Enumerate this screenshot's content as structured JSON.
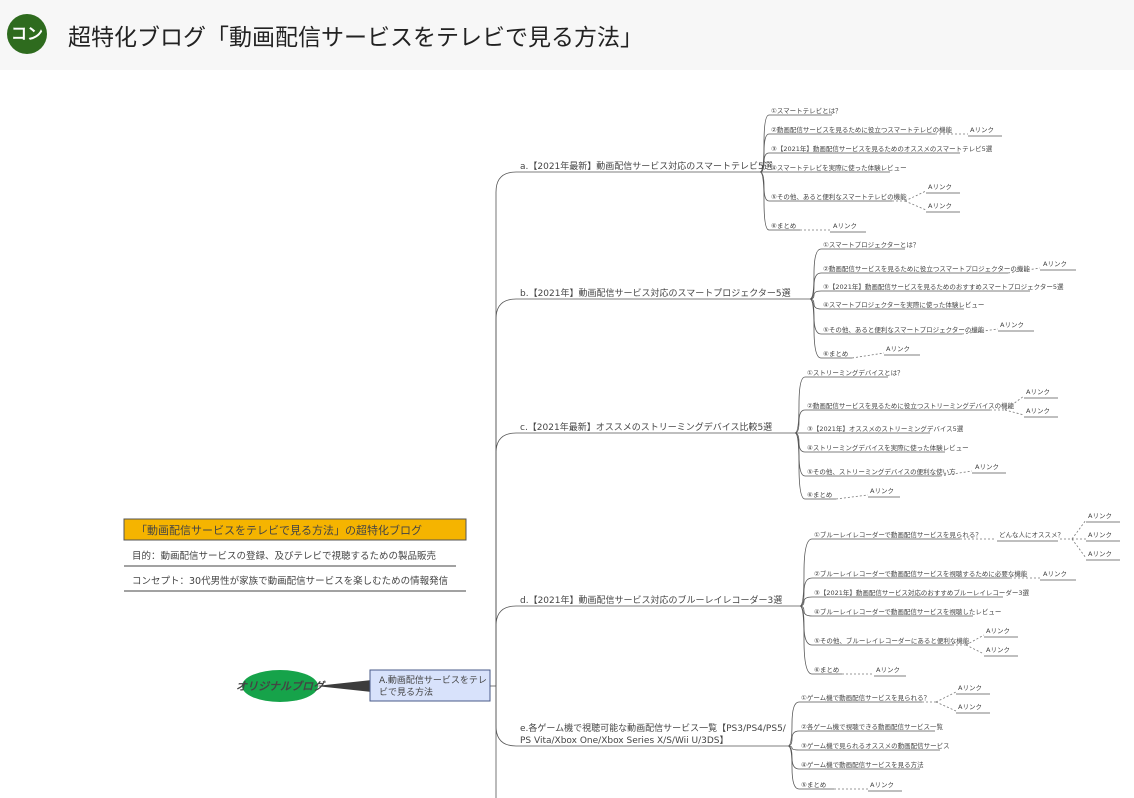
{
  "header": {
    "avatar_text": "コン",
    "title": "超特化ブログ「動画配信サービスをテレビで見る方法」"
  },
  "colors": {
    "avatar": "#2e6b1e",
    "root_node": "#16a34a",
    "center_fill": "#d8e2fb",
    "center_border": "#4a5b8a",
    "info_title_fill": "#f5b400"
  },
  "map": {
    "root_label": "オリジナルブログ",
    "center_line1": "A.動画配信サービスをテレ",
    "center_line2": "ビで見る方法",
    "info": {
      "title": "「動画配信サービスをテレビで見る方法」の超特化ブログ",
      "purpose": "目的：動画配信サービスの登録、及びテレビで視聴するための製品販売",
      "concept": "コンセプト：30代男性が家族で動画配信サービスを楽しむための情報発信"
    },
    "branches": [
      {
        "label": "a.【2021年最新】動画配信サービス対応のスマートテレビ5選",
        "children": [
          {
            "label": "①スマートテレビとは？",
            "links": []
          },
          {
            "label": "②動画配信サービスを見るために役立つスマートテレビの機能",
            "links": [
              "Aリンク"
            ]
          },
          {
            "label": "③【2021年】動画配信サービスを見るためのオススメのスマートテレビ5選",
            "links": []
          },
          {
            "label": "④スマートテレビを実際に使った体験レビュー",
            "links": []
          },
          {
            "label": "⑤その他、あると便利なスマートテレビの機能",
            "links": [
              "Aリンク",
              "Aリンク"
            ]
          },
          {
            "label": "⑥まとめ",
            "links": [
              "Aリンク"
            ]
          }
        ]
      },
      {
        "label": "b.【2021年】動画配信サービス対応のスマートプロジェクター5選",
        "children": [
          {
            "label": "①スマートプロジェクターとは？",
            "links": []
          },
          {
            "label": "②動画配信サービスを見るために役立つスマートプロジェクターの機能",
            "links": [
              "Aリンク"
            ]
          },
          {
            "label": "③【2021年】動画配信サービスを見るためのおすすめスマートプロジェクター5選",
            "links": []
          },
          {
            "label": "④スマートプロジェクターを実際に使った体験レビュー",
            "links": []
          },
          {
            "label": "⑤その他、あると便利なスマートプロジェクターの機能",
            "links": [
              "Aリンク"
            ]
          },
          {
            "label": "⑥まとめ",
            "links": [
              "Aリンク"
            ]
          }
        ]
      },
      {
        "label": "c.【2021年最新】オススメのストリーミングデバイス比較5選",
        "children": [
          {
            "label": "①ストリーミングデバイスとは？",
            "links": []
          },
          {
            "label": "②動画配信サービスを見るために役立つストリーミングデバイスの機能",
            "links": [
              "Aリンク",
              "Aリンク"
            ]
          },
          {
            "label": "③【2021年】オススメのストリーミングデバイス5選",
            "links": []
          },
          {
            "label": "④ストリーミングデバイスを実際に使った体験レビュー",
            "links": []
          },
          {
            "label": "⑤その他、ストリーミングデバイスの便利な使い方",
            "links": [
              "Aリンク"
            ]
          },
          {
            "label": "⑥まとめ",
            "links": [
              "Aリンク"
            ]
          }
        ]
      },
      {
        "label": "d.【2021年】動画配信サービス対応のブルーレイレコーダー3選",
        "children": [
          {
            "label": "①ブルーレイレコーダーで動画配信サービスを見られる？",
            "sub": "どんな人にオススメ？",
            "links": [
              "Aリンク",
              "Aリンク",
              "Aリンク"
            ]
          },
          {
            "label": "②ブルーレイレコーダーで動画配信サービスを視聴するために必要な機能",
            "links": [
              "Aリンク"
            ]
          },
          {
            "label": "③【2021年】動画配信サービス対応のおすすめブルーレイレコーダー3選",
            "links": []
          },
          {
            "label": "④ブルーレイレコーダーで動画配信サービスを視聴したレビュー",
            "links": []
          },
          {
            "label": "⑤その他、ブルーレイレコーダーにあると便利な機能",
            "links": [
              "Aリンク",
              "Aリンク"
            ]
          },
          {
            "label": "⑥まとめ",
            "links": [
              "Aリンク"
            ]
          }
        ]
      },
      {
        "label_line1": "e.各ゲーム機で視聴可能な動画配信サービス一覧【PS3/PS4/PS5/",
        "label_line2": "PS Vita/Xbox One/Xbox Series X/S/Wii U/3DS】",
        "children": [
          {
            "label": "①ゲーム機で動画配信サービスを見られる？",
            "links": [
              "Aリンク",
              "Aリンク"
            ]
          },
          {
            "label": "②各ゲーム機で視聴できる動画配信サービス一覧",
            "links": []
          },
          {
            "label": "③ゲーム機で見られるオススメの動画配信サービス",
            "links": []
          },
          {
            "label": "④ゲーム機で動画配信サービスを見る方法",
            "links": []
          },
          {
            "label": "⑤まとめ",
            "links": [
              "Aリンク"
            ]
          }
        ]
      }
    ]
  }
}
